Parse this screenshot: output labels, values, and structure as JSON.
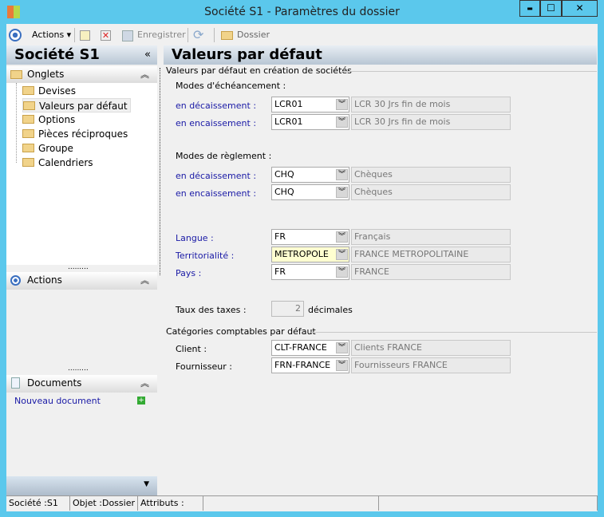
{
  "window": {
    "title": "Société S1 -  Paramètres du dossier",
    "minimize": "▬",
    "maximize": "☐",
    "close": "✕"
  },
  "toolbar": {
    "actions": "Actions ▾",
    "save": "Enregistrer",
    "dossier": "Dossier"
  },
  "left": {
    "title": "Société S1",
    "collapse": "«",
    "onglets": {
      "label": "Onglets",
      "items": [
        "Devises",
        "Valeurs par défaut",
        "Options",
        "Pièces réciproques",
        "Groupe",
        "Calendriers"
      ]
    },
    "actions": {
      "label": "Actions"
    },
    "documents": {
      "label": "Documents",
      "new_doc": "Nouveau document"
    }
  },
  "main": {
    "title": "Valeurs par défaut",
    "group1": "Valeurs par défaut en création de sociétés",
    "echeance": {
      "label": "Modes d'échéancement :",
      "rows": [
        {
          "label": "en décaissement :",
          "code": "LCR01",
          "desc": "LCR 30 Jrs  fin de  mois"
        },
        {
          "label": "en encaissement :",
          "code": "LCR01",
          "desc": "LCR 30 Jrs  fin de  mois"
        }
      ]
    },
    "reglement": {
      "label": "Modes de règlement :",
      "rows": [
        {
          "label": "en décaissement :",
          "code": "CHQ",
          "desc": "Chèques"
        },
        {
          "label": "en encaissement :",
          "code": "CHQ",
          "desc": "Chèques"
        }
      ]
    },
    "locale": [
      {
        "label": "Langue :",
        "code": "FR",
        "desc": "Français"
      },
      {
        "label": "Territorialité :",
        "code": "METROPOLE",
        "desc": "FRANCE METROPOLITAINE"
      },
      {
        "label": "Pays :",
        "code": "FR",
        "desc": "FRANCE"
      }
    ],
    "taxes": {
      "label": "Taux des taxes :",
      "value": "2",
      "unit": "décimales"
    },
    "group2": "Catégories comptables par défaut",
    "categories": [
      {
        "label": "Client :",
        "code": "CLT-FRANCE",
        "desc": "Clients FRANCE"
      },
      {
        "label": "Fournisseur :",
        "code": "FRN-FRANCE",
        "desc": "Fournisseurs FRANCE"
      }
    ]
  },
  "status": [
    "Société :S1",
    "Objet :Dossier",
    "Attributs :",
    "",
    ""
  ]
}
